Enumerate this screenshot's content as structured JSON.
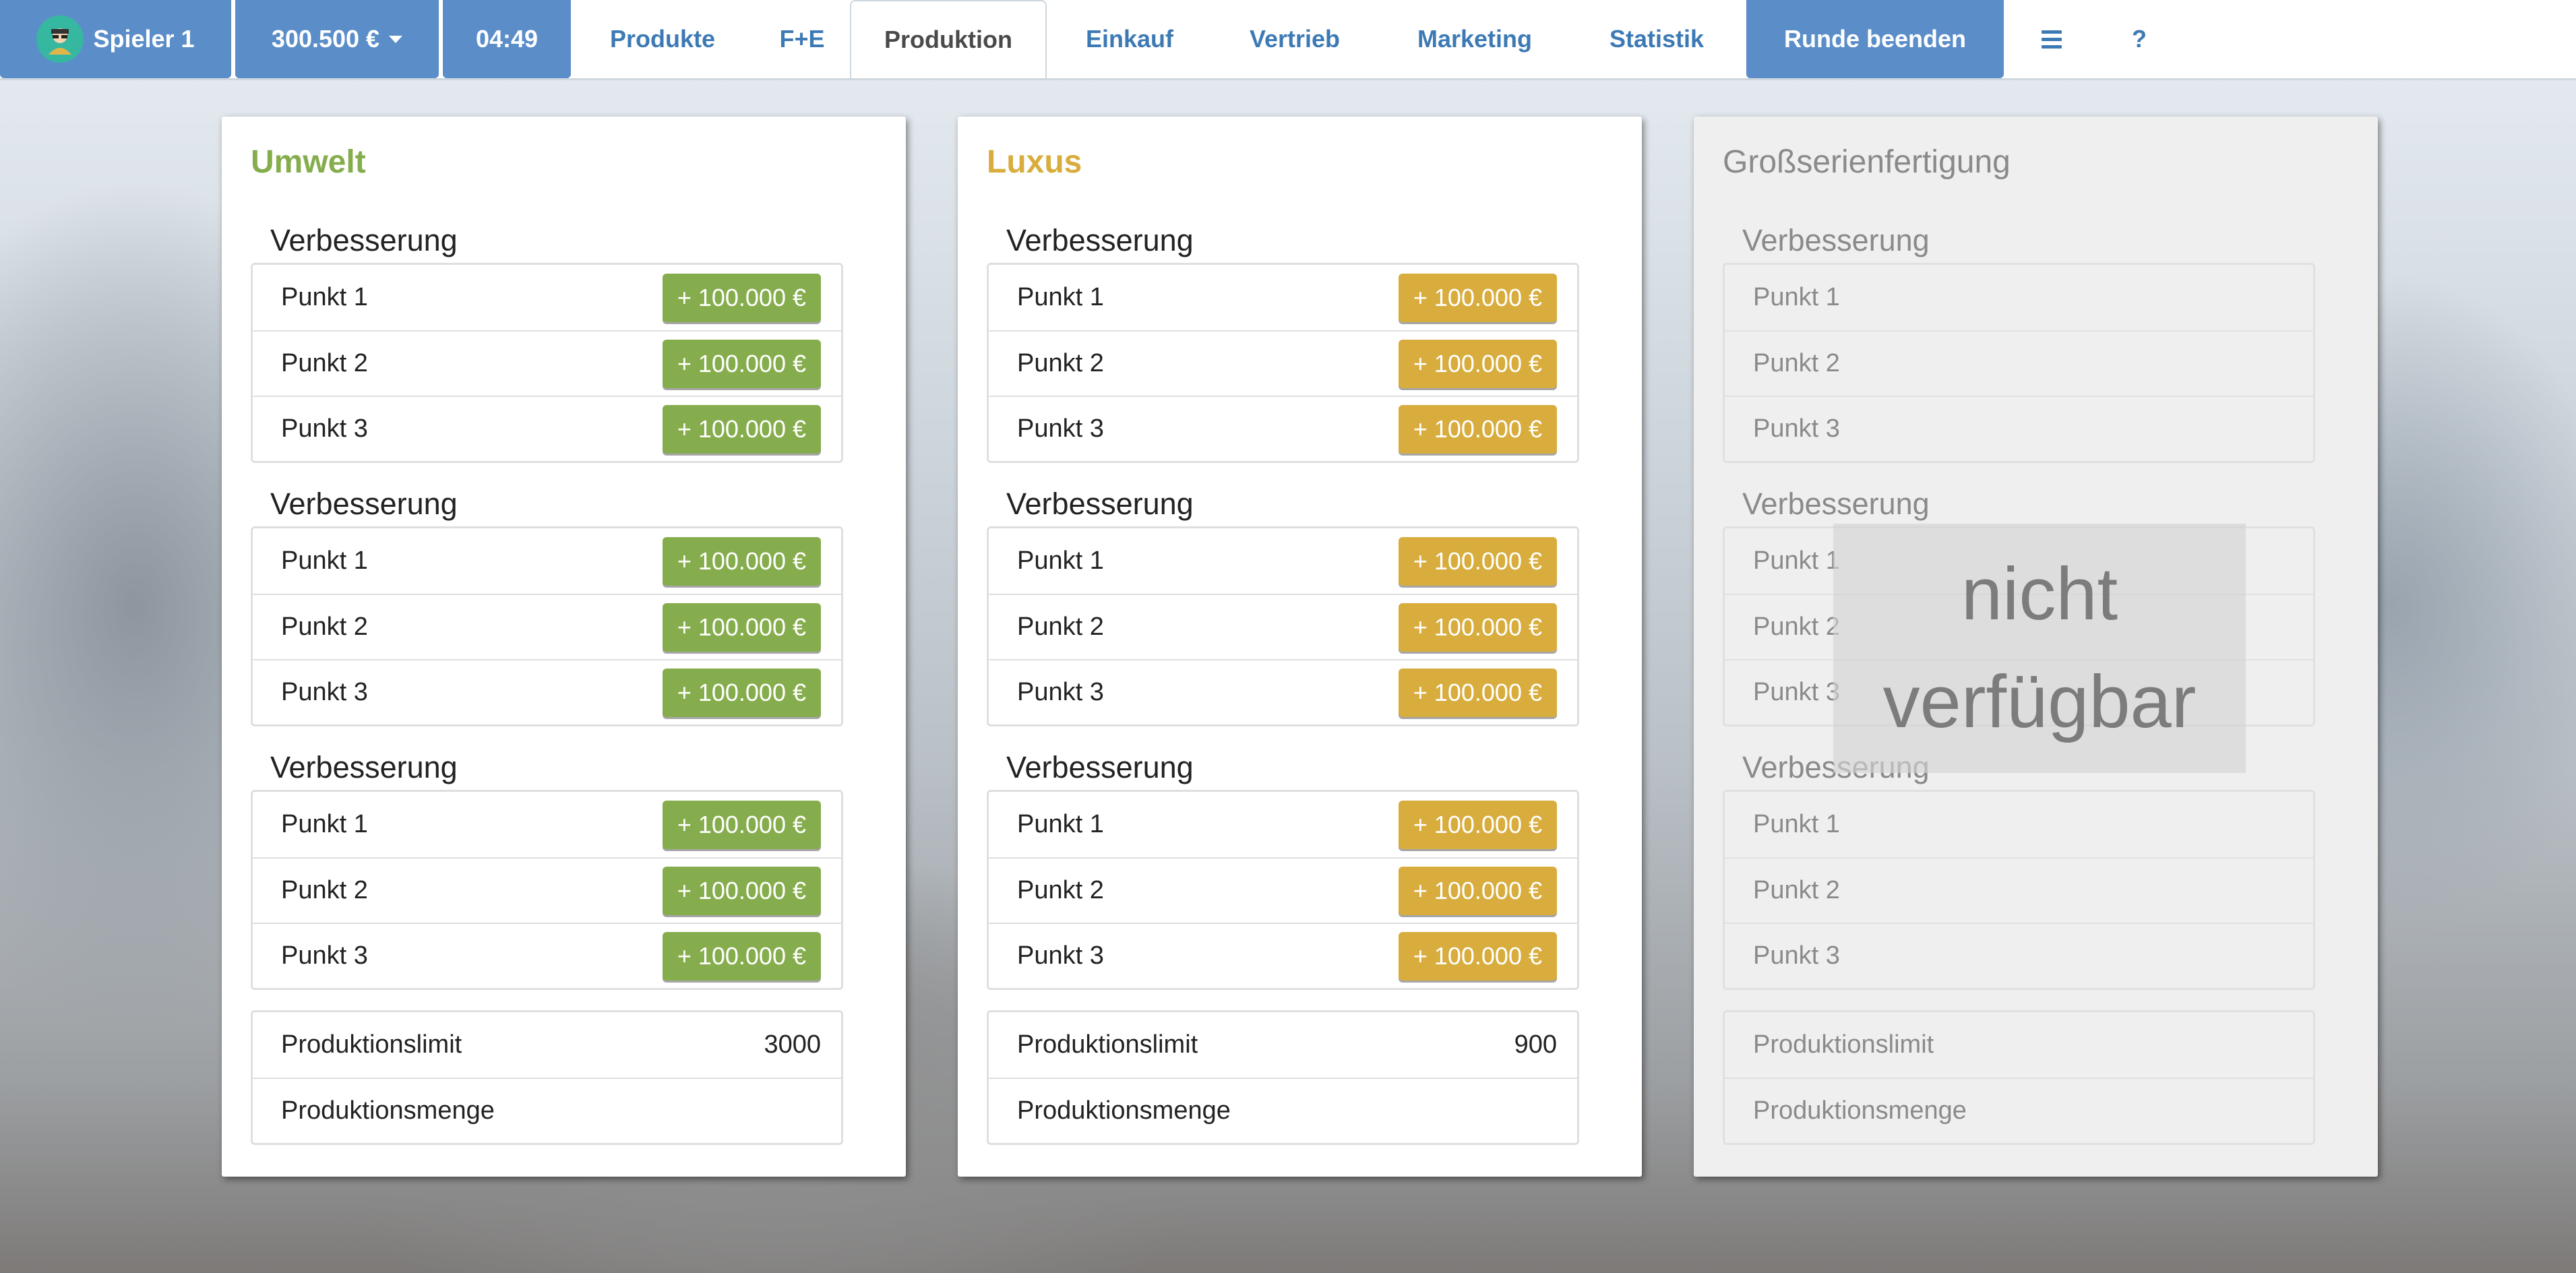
{
  "nav": {
    "player": "Spieler 1",
    "balance": "300.500 €",
    "timer": "04:49",
    "links": [
      "Produkte",
      "F+E",
      "Produktion",
      "Einkauf",
      "Vertrieb",
      "Marketing",
      "Statistik"
    ],
    "end_round": "Runde beenden",
    "help": "?"
  },
  "panels": [
    {
      "title": "Umwelt",
      "color": "#86ad4d",
      "sections": [
        {
          "title": "Verbesserung",
          "items": [
            {
              "label": "Punkt 1",
              "button": "+ 100.000 €"
            },
            {
              "label": "Punkt 2",
              "button": "+ 100.000 €"
            },
            {
              "label": "Punkt 3",
              "button": "+ 100.000 €"
            }
          ]
        },
        {
          "title": "Verbesserung",
          "items": [
            {
              "label": "Punkt 1",
              "button": "+ 100.000 €"
            },
            {
              "label": "Punkt 2",
              "button": "+ 100.000 €"
            },
            {
              "label": "Punkt 3",
              "button": "+ 100.000 €"
            }
          ]
        },
        {
          "title": "Verbesserung",
          "items": [
            {
              "label": "Punkt 1",
              "button": "+ 100.000 €"
            },
            {
              "label": "Punkt 2",
              "button": "+ 100.000 €"
            },
            {
              "label": "Punkt 3",
              "button": "+ 100.000 €"
            }
          ]
        }
      ],
      "limit_label": "Produktionslimit",
      "limit_value": "3000",
      "quantity_label": "Produktionsmenge"
    },
    {
      "title": "Luxus",
      "color": "#d8ad3e",
      "sections": [
        {
          "title": "Verbesserung",
          "items": [
            {
              "label": "Punkt 1",
              "button": "+ 100.000 €"
            },
            {
              "label": "Punkt 2",
              "button": "+ 100.000 €"
            },
            {
              "label": "Punkt 3",
              "button": "+ 100.000 €"
            }
          ]
        },
        {
          "title": "Verbesserung",
          "items": [
            {
              "label": "Punkt 1",
              "button": "+ 100.000 €"
            },
            {
              "label": "Punkt 2",
              "button": "+ 100.000 €"
            },
            {
              "label": "Punkt 3",
              "button": "+ 100.000 €"
            }
          ]
        },
        {
          "title": "Verbesserung",
          "items": [
            {
              "label": "Punkt 1",
              "button": "+ 100.000 €"
            },
            {
              "label": "Punkt 2",
              "button": "+ 100.000 €"
            },
            {
              "label": "Punkt 3",
              "button": "+ 100.000 €"
            }
          ]
        }
      ],
      "limit_label": "Produktionslimit",
      "limit_value": "900",
      "quantity_label": "Produktionsmenge"
    },
    {
      "title": "Großserienfertigung",
      "sections": [
        {
          "title": "Verbesserung",
          "items": [
            {
              "label": "Punkt 1"
            },
            {
              "label": "Punkt 2"
            },
            {
              "label": "Punkt 3"
            }
          ]
        },
        {
          "title": "Verbesserung",
          "items": [
            {
              "label": "Punkt 1"
            },
            {
              "label": "Punkt 2"
            },
            {
              "label": "Punkt 3"
            }
          ]
        },
        {
          "title": "Verbesserung",
          "items": [
            {
              "label": "Punkt 1"
            },
            {
              "label": "Punkt 2"
            },
            {
              "label": "Punkt 3"
            }
          ]
        }
      ],
      "limit_label": "Produktionslimit",
      "quantity_label": "Produktionsmenge",
      "overlay_line1": "nicht",
      "overlay_line2": "verfügbar"
    }
  ],
  "colors": {
    "nav_accent": "#5b8ec9",
    "link": "#3d7ab5"
  }
}
